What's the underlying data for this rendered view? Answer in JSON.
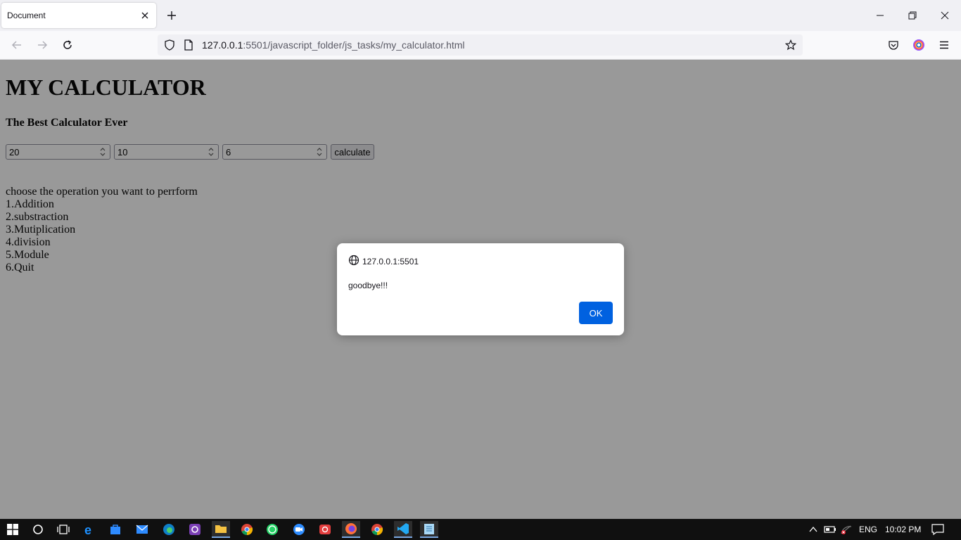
{
  "browser": {
    "tab_title": "Document",
    "url_host": "127.0.0.1",
    "url_rest": ":5501/javascript_folder/js_tasks/my_calculator.html"
  },
  "page": {
    "heading": "MY CALCULATOR",
    "subheading": "The Best Calculator Ever",
    "inputs": [
      "20",
      "10",
      "6"
    ],
    "button_label": "calculate",
    "menu": [
      "choose the operation you want to perrform",
      "1.Addition",
      "2.substraction",
      "3.Mutiplication",
      "4.division",
      "5.Module",
      "6.Quit"
    ]
  },
  "dialog": {
    "origin": "127.0.0.1:5501",
    "message": "goodbye!!!",
    "ok_label": "OK"
  },
  "taskbar": {
    "language": "ENG",
    "time": "10:02 PM"
  },
  "colors": {
    "accent": "#0061e0",
    "taskbar": "#101010"
  }
}
